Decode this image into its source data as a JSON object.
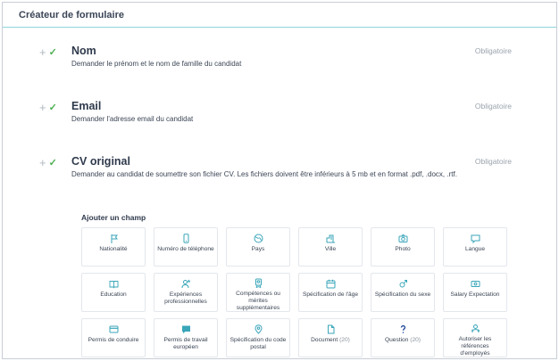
{
  "header": {
    "title": "Créateur de formulaire"
  },
  "fields": [
    {
      "name": "Nom",
      "description": "Demander le prénom et le nom de famille du candidat",
      "badge": "Obligatoire"
    },
    {
      "name": "Email",
      "description": "Demander l'adresse email du candidat",
      "badge": "Obligatoire"
    },
    {
      "name": "CV original",
      "description": "Demander au candidat de soumettre son fichier CV. Les fichiers doivent être inférieurs à 5 mb et en format .pdf, .docx, .rtf.",
      "badge": "Obligatoire"
    }
  ],
  "add_field": {
    "title": "Ajouter un champ",
    "cards": [
      {
        "label": "Nationalité",
        "icon": "flag-icon"
      },
      {
        "label": "Numéro de téléphone",
        "icon": "phone-icon"
      },
      {
        "label": "Pays",
        "icon": "globe-icon"
      },
      {
        "label": "Ville",
        "icon": "city-icon"
      },
      {
        "label": "Photo",
        "icon": "camera-icon"
      },
      {
        "label": "Langue",
        "icon": "chat-icon"
      },
      {
        "label": "Education",
        "icon": "book-icon"
      },
      {
        "label": "Expériences professionnelles",
        "icon": "user-star-icon"
      },
      {
        "label": "Compétences ou mérites supplémentaires",
        "icon": "badge-icon"
      },
      {
        "label": "Spécification de l'âge",
        "icon": "calendar-icon"
      },
      {
        "label": "Spécification du sexe",
        "icon": "gender-icon"
      },
      {
        "label": "Salary Expectation",
        "icon": "money-icon"
      },
      {
        "label": "Permis de conduire",
        "icon": "card-icon"
      },
      {
        "label": "Permis de travail européen",
        "icon": "message-icon"
      },
      {
        "label": "Spécification du code postal",
        "icon": "pin-icon"
      },
      {
        "label": "Document",
        "count": "(20)",
        "icon": "document-icon"
      },
      {
        "label": "Question",
        "count": "(20)",
        "icon": "question-icon"
      },
      {
        "label": "Autoriser les références d'employés",
        "icon": "users-icon"
      }
    ]
  },
  "colors": {
    "accent": "#3aa6b9",
    "check": "#4caf50",
    "header_rule": "#8fd3d9"
  }
}
